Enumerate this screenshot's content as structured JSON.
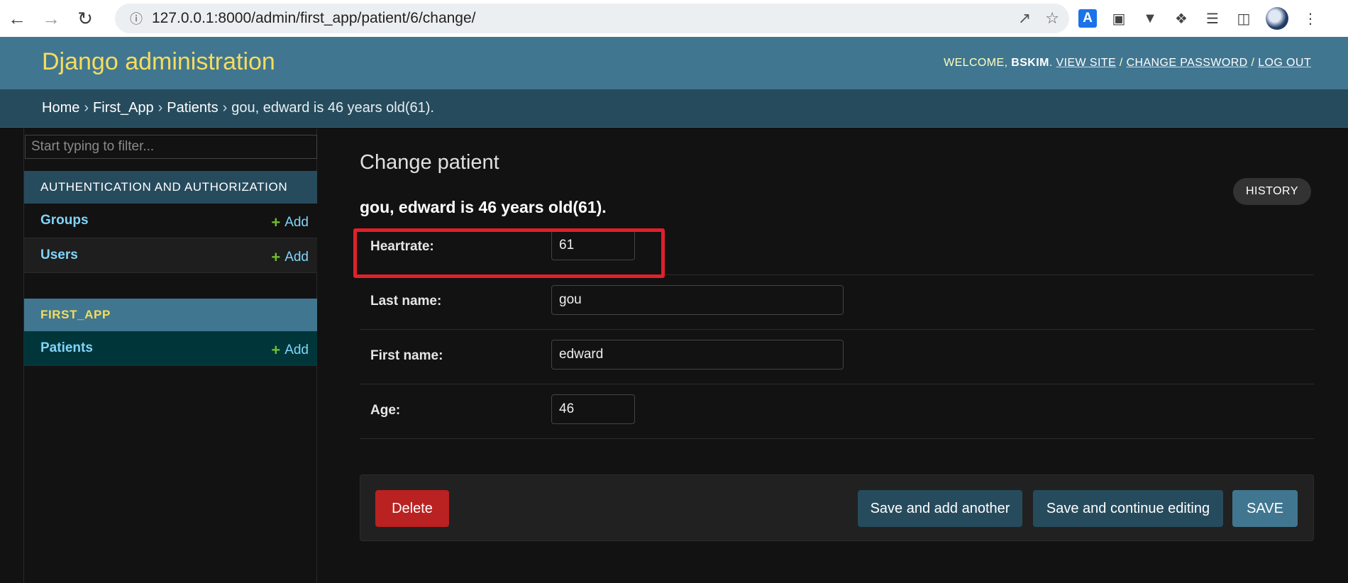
{
  "browser": {
    "url": "127.0.0.1:8000/admin/first_app/patient/6/change/",
    "back_icon": "arrow-left-icon",
    "forward_icon": "arrow-right-icon",
    "reload_icon": "reload-icon",
    "translate_letter": "A"
  },
  "header": {
    "site_title": "Django administration",
    "welcome": "WELCOME, ",
    "username": "BSKIM",
    "view_site": "VIEW SITE",
    "change_password": "CHANGE PASSWORD",
    "log_out": "LOG OUT",
    "separator": " / "
  },
  "breadcrumbs": {
    "home": "Home",
    "app": "First_App",
    "model": "Patients",
    "current": "gou, edward is 46 years old(61).",
    "sep": "›"
  },
  "sidebar": {
    "filter_placeholder": "Start typing to filter...",
    "apps": [
      {
        "caption": "AUTHENTICATION AND AUTHORIZATION",
        "models": [
          {
            "name": "Groups",
            "add": "Add"
          },
          {
            "name": "Users",
            "add": "Add"
          }
        ]
      },
      {
        "caption": "FIRST_APP",
        "models": [
          {
            "name": "Patients",
            "add": "Add"
          }
        ]
      }
    ]
  },
  "content": {
    "heading": "Change patient",
    "history": "HISTORY",
    "object_title": "gou, edward is 46 years old(61).",
    "fields": [
      {
        "label": "Heartrate:",
        "value": "61"
      },
      {
        "label": "Last name:",
        "value": "gou"
      },
      {
        "label": "First name:",
        "value": "edward"
      },
      {
        "label": "Age:",
        "value": "46"
      }
    ],
    "buttons": {
      "delete": "Delete",
      "save_add": "Save and add another",
      "save_continue": "Save and continue editing",
      "save": "SAVE"
    }
  },
  "colors": {
    "header_bg": "#417690",
    "breadcrumb_bg": "#264b5d",
    "site_title": "#f5dd5d",
    "link": "#81d4fa",
    "delete": "#ba2121",
    "highlight": "#e0202a"
  }
}
